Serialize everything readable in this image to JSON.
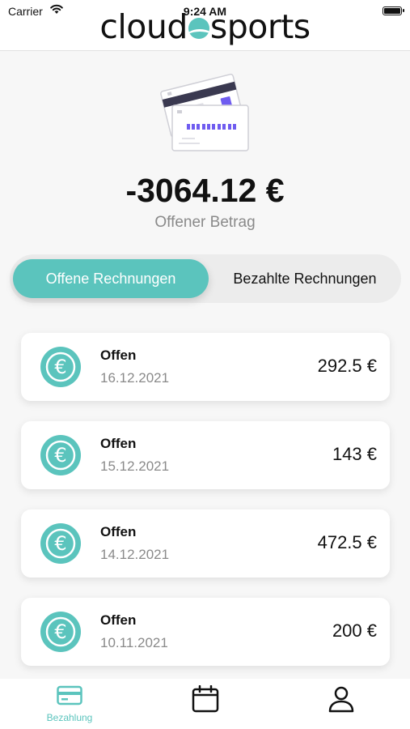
{
  "status_bar": {
    "carrier": "Carrier",
    "time": "9:24 AM",
    "battery": "full"
  },
  "header": {
    "logo_text": "cloudsports",
    "logo_left": "cloud",
    "logo_right": "sports",
    "accent_color": "#5bc4bd"
  },
  "summary": {
    "amount": "-3064.12 €",
    "label": "Offener Betrag"
  },
  "tabs_segment": {
    "active": "Offene Rechnungen",
    "inactive": "Bezahlte Rechnungen"
  },
  "invoices": [
    {
      "status": "Offen",
      "date": "16.12.2021",
      "amount": "292.5 €",
      "icon": "euro-icon"
    },
    {
      "status": "Offen",
      "date": "15.12.2021",
      "amount": "143 €",
      "icon": "euro-icon"
    },
    {
      "status": "Offen",
      "date": "14.12.2021",
      "amount": "472.5 €",
      "icon": "euro-icon"
    },
    {
      "status": "Offen",
      "date": "10.11.2021",
      "amount": "200 €",
      "icon": "euro-icon"
    }
  ],
  "bottom_nav": {
    "items": [
      {
        "label": "Bezahlung",
        "icon": "credit-card-icon",
        "active": true
      },
      {
        "label": "",
        "icon": "calendar-icon",
        "active": false
      },
      {
        "label": "",
        "icon": "user-icon",
        "active": false
      }
    ]
  }
}
